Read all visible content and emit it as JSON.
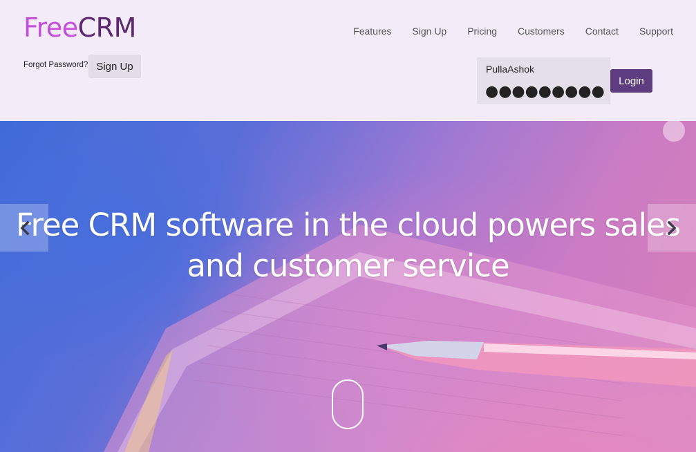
{
  "brand": {
    "part1": "Free",
    "part2": "CRM"
  },
  "nav": {
    "items": [
      {
        "label": "Features"
      },
      {
        "label": "Sign Up"
      },
      {
        "label": "Pricing"
      },
      {
        "label": "Customers"
      },
      {
        "label": "Contact"
      },
      {
        "label": "Support"
      }
    ]
  },
  "auth": {
    "forgot_label": "Forgot Password?",
    "signup_label": "Sign Up",
    "username_value": "PullaAshok",
    "password_mask": "●●●●●●●●●",
    "login_label": "Login"
  },
  "hero": {
    "title_line1": "Free CRM software in the cloud powers sales",
    "title_line2": "and customer service"
  },
  "colors": {
    "brand_free": "#c24fd7",
    "brand_crm": "#5b2770",
    "login_button": "#5d3c80",
    "header_bg": "#f3ebf7"
  },
  "icons": {
    "prev": "chevron-left-icon",
    "next": "chevron-right-icon",
    "scroll": "mouse-scroll-icon"
  }
}
